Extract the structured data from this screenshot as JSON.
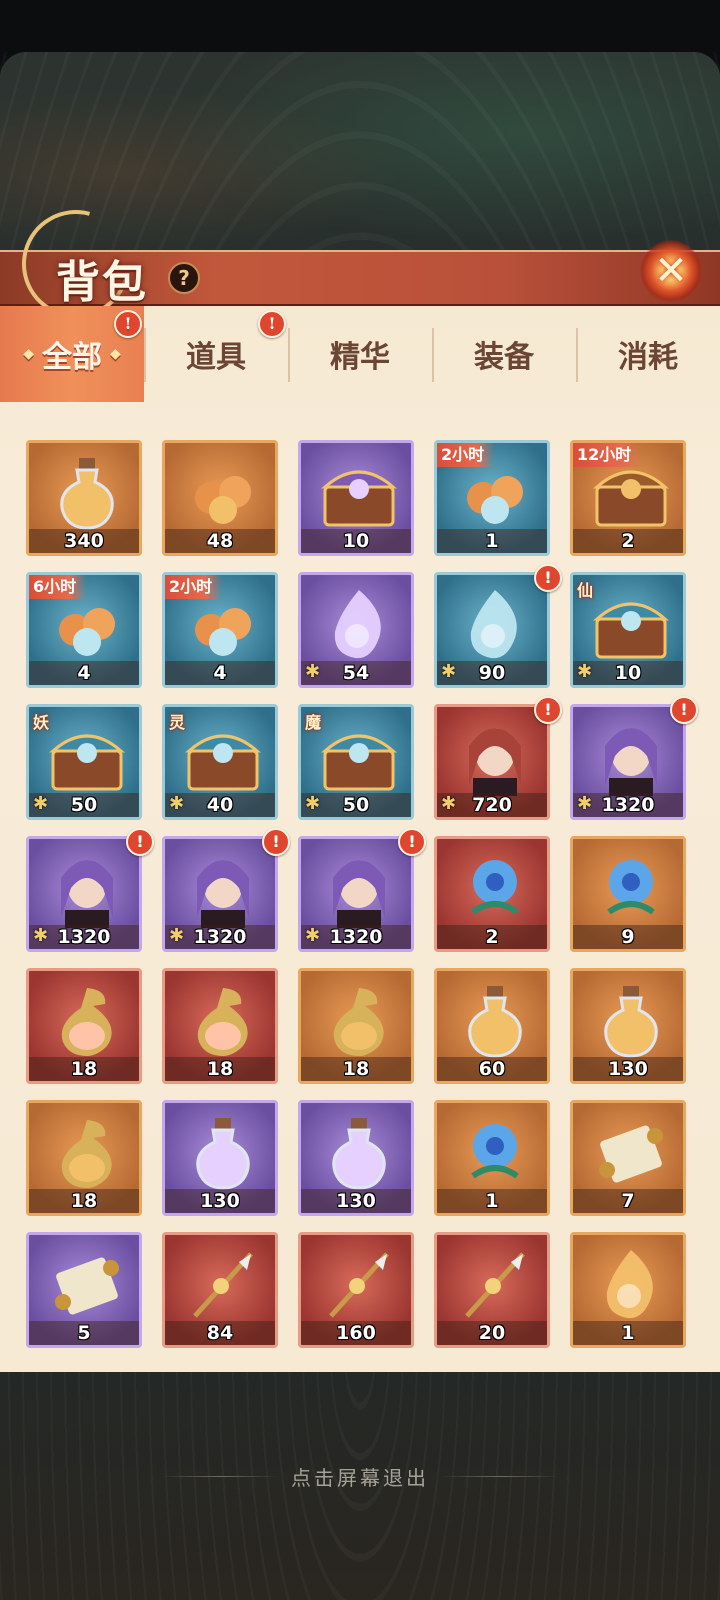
{
  "header": {
    "title": "背包",
    "help_icon": "?",
    "close_icon": "✕"
  },
  "tabs": [
    {
      "label": "全部",
      "active": true,
      "alert": true
    },
    {
      "label": "道具",
      "active": false,
      "alert": true
    },
    {
      "label": "精华",
      "active": false,
      "alert": false
    },
    {
      "label": "装备",
      "active": false,
      "alert": false
    },
    {
      "label": "消耗",
      "active": false,
      "alert": false
    }
  ],
  "alert_glyph": "!",
  "items": [
    {
      "icon": "potion-basket-icon",
      "frame": "orange",
      "qty": "340"
    },
    {
      "icon": "treasure-book-icon",
      "frame": "orange",
      "qty": "48"
    },
    {
      "icon": "gold-coin-box-icon",
      "frame": "purple",
      "qty": "10"
    },
    {
      "icon": "orange-orbs-icon",
      "frame": "blue",
      "qty": "1",
      "timer": "2小时"
    },
    {
      "icon": "jade-chest-icon",
      "frame": "orange",
      "qty": "2",
      "timer": "12小时"
    },
    {
      "icon": "jade-bag-icon",
      "frame": "blue",
      "qty": "4",
      "timer": "6小时"
    },
    {
      "icon": "jade-pile-icon",
      "frame": "blue",
      "qty": "4",
      "timer": "2小时"
    },
    {
      "icon": "purple-flame-icon",
      "frame": "purple",
      "qty": "54",
      "fragment": true
    },
    {
      "icon": "blue-flame-icon",
      "frame": "blue",
      "qty": "90",
      "fragment": true,
      "alert": true
    },
    {
      "icon": "golden-chest-icon",
      "frame": "blue",
      "qty": "10",
      "fragment": true,
      "tag": "仙"
    },
    {
      "icon": "red-spirit-chest-icon",
      "frame": "blue",
      "qty": "50",
      "fragment": true,
      "tag": "妖"
    },
    {
      "icon": "green-spirit-chest-icon",
      "frame": "blue",
      "qty": "40",
      "fragment": true,
      "tag": "灵"
    },
    {
      "icon": "purple-spirit-chest-icon",
      "frame": "blue",
      "qty": "50",
      "fragment": true,
      "tag": "魔"
    },
    {
      "icon": "hero-portrait-red-hair-icon",
      "frame": "red",
      "qty": "720",
      "fragment": true,
      "alert": true
    },
    {
      "icon": "hero-portrait-purple-hair-icon",
      "frame": "purple",
      "qty": "1320",
      "fragment": true,
      "alert": true
    },
    {
      "icon": "hero-portrait-fox-ears-icon",
      "frame": "purple",
      "qty": "1320",
      "fragment": true,
      "alert": true
    },
    {
      "icon": "hero-portrait-crowned-icon",
      "frame": "purple",
      "qty": "1320",
      "fragment": true,
      "alert": true
    },
    {
      "icon": "hero-portrait-scholar-icon",
      "frame": "purple",
      "qty": "1320",
      "fragment": true,
      "alert": true
    },
    {
      "icon": "blue-flower-icon",
      "frame": "red",
      "qty": "2"
    },
    {
      "icon": "blue-orchid-icon",
      "frame": "orange",
      "qty": "9"
    },
    {
      "icon": "red-elixir-vessel-icon",
      "frame": "red",
      "qty": "18"
    },
    {
      "icon": "green-elixir-vessel-icon",
      "frame": "red",
      "qty": "18"
    },
    {
      "icon": "purple-elixir-vessel-icon",
      "frame": "orange",
      "qty": "18"
    },
    {
      "icon": "red-potion-icon",
      "frame": "orange",
      "qty": "60"
    },
    {
      "icon": "green-potion-icon",
      "frame": "orange",
      "qty": "130"
    },
    {
      "icon": "red-golden-vessel-icon",
      "frame": "orange",
      "qty": "18"
    },
    {
      "icon": "purple-potion-icon",
      "frame": "purple",
      "qty": "130"
    },
    {
      "icon": "yellow-potion-icon",
      "frame": "purple",
      "qty": "130"
    },
    {
      "icon": "red-lantern-flower-icon",
      "frame": "orange",
      "qty": "1"
    },
    {
      "icon": "golden-scroll-icon",
      "frame": "orange",
      "qty": "7"
    },
    {
      "icon": "white-scroll-icon",
      "frame": "purple",
      "qty": "5"
    },
    {
      "icon": "moon-staff-icon",
      "frame": "red",
      "qty": "84"
    },
    {
      "icon": "golden-spear-icon",
      "frame": "red",
      "qty": "160"
    },
    {
      "icon": "steel-spear-icon",
      "frame": "red",
      "qty": "20"
    },
    {
      "icon": "fire-crystal-icon",
      "frame": "orange",
      "qty": "1"
    }
  ],
  "footer": {
    "exit_hint": "点击屏幕退出"
  }
}
